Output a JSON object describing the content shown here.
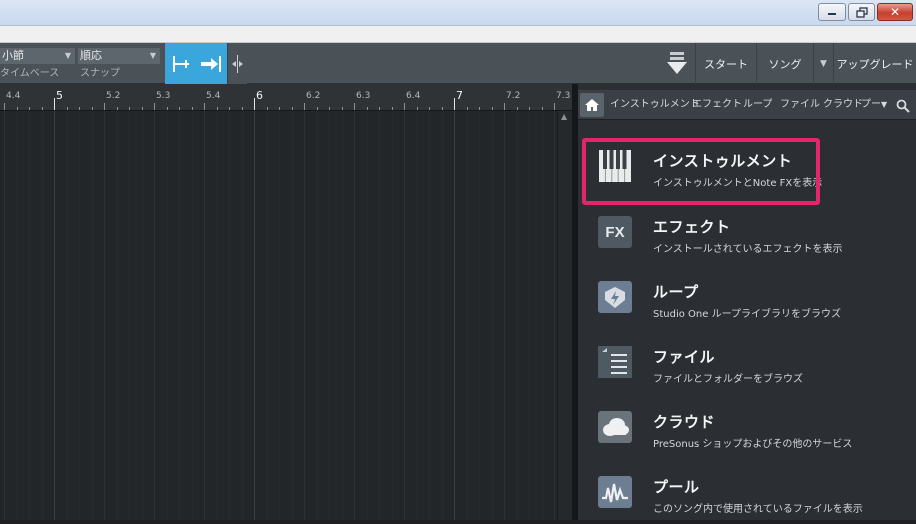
{
  "toolbar": {
    "timebase_value": "小節",
    "timebase_label": "タイムベース",
    "snap_value": "順応",
    "snap_label": "スナップ",
    "start_label": "スタート",
    "song_label": "ソング",
    "upgrade_label": "アップグレード"
  },
  "ruler": {
    "labels": [
      "4.4",
      "5",
      "5.2",
      "5.3",
      "5.4",
      "6",
      "6.2",
      "6.3",
      "6.4",
      "7",
      "7.2",
      "7.3"
    ]
  },
  "browser": {
    "tabs": [
      "インストゥルメント",
      "エフェクト",
      "ループ",
      "ファイル",
      "クラウド",
      "プー"
    ],
    "items": [
      {
        "title": "インストゥルメント",
        "subtitle": "インストゥルメントとNote FXを表示",
        "icon": "piano-icon"
      },
      {
        "title": "エフェクト",
        "subtitle": "インストールされているエフェクトを表示",
        "icon": "fx-icon",
        "icon_text": "FX"
      },
      {
        "title": "ループ",
        "subtitle": "Studio One ループライブラリをブラウズ",
        "icon": "loop-icon"
      },
      {
        "title": "ファイル",
        "subtitle": "ファイルとフォルダーをブラウズ",
        "icon": "folder-icon"
      },
      {
        "title": "クラウド",
        "subtitle": "PreSonus ショップおよびその他のサービス",
        "icon": "cloud-icon"
      },
      {
        "title": "プール",
        "subtitle": "このソング内で使用されているファイルを表示",
        "icon": "pool-icon"
      }
    ]
  },
  "colors": {
    "highlight": "#e3266b",
    "snap_accent": "#3aa6dc",
    "panel_bg": "#2b2f33"
  }
}
